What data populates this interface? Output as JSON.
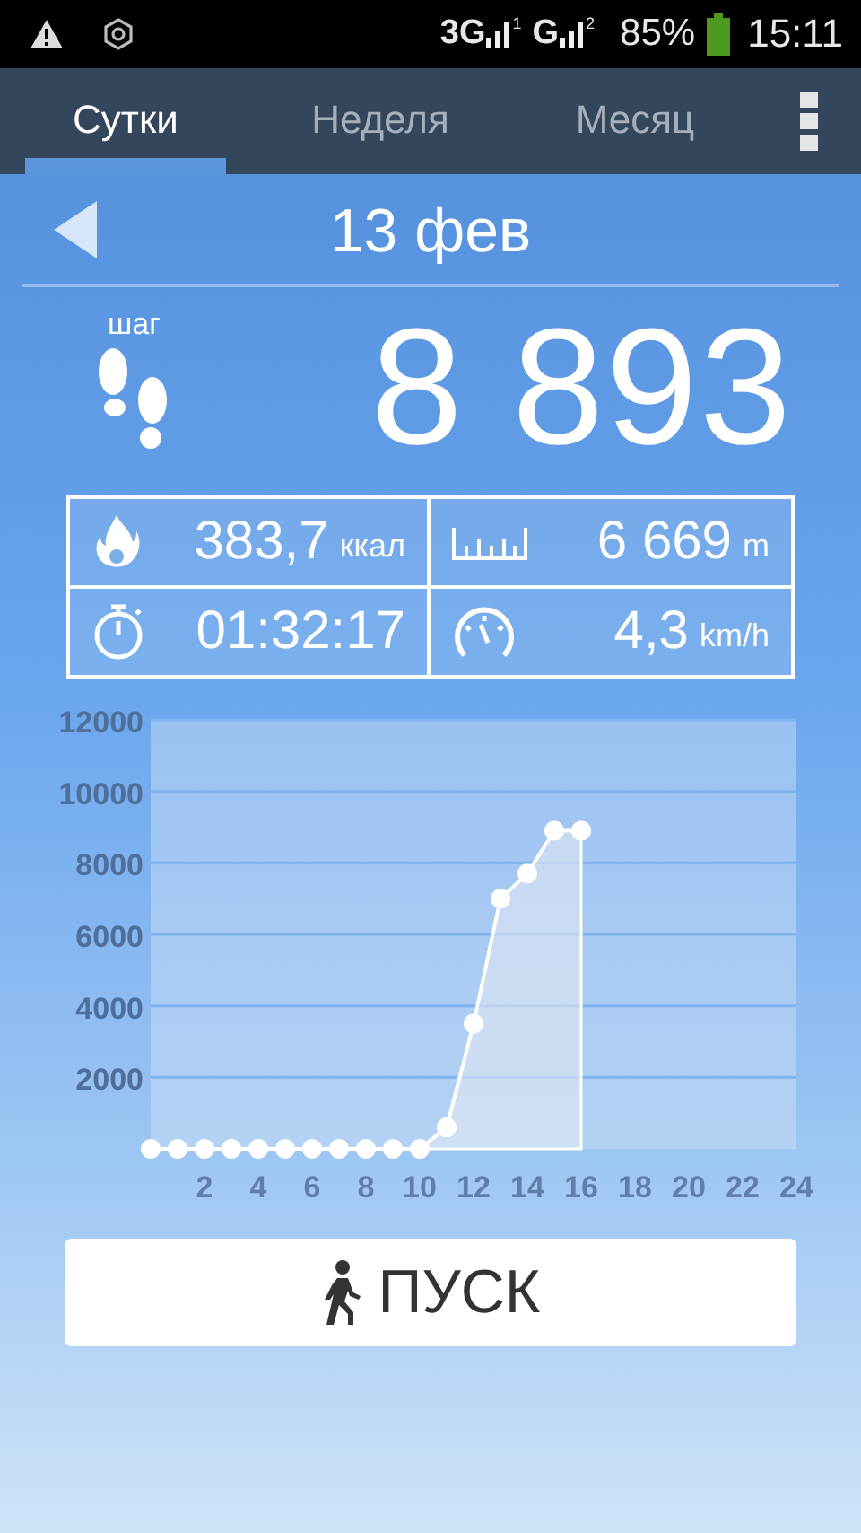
{
  "status_bar": {
    "network_1": "3G",
    "sim_1": "1",
    "network_2": "G",
    "sim_2": "2",
    "battery": "85%",
    "time": "15:11"
  },
  "tabs": [
    {
      "label": "Сутки",
      "selected": true
    },
    {
      "label": "Неделя",
      "selected": false
    },
    {
      "label": "Месяц",
      "selected": false
    }
  ],
  "date": "13 фев",
  "steps": {
    "label": "шаг",
    "value": "8 893"
  },
  "stats": [
    {
      "kind": "calories",
      "value": "383,7",
      "unit": "ккал"
    },
    {
      "kind": "distance",
      "value": "6 669",
      "unit": "m"
    },
    {
      "kind": "duration",
      "value": "01:32:17"
    },
    {
      "kind": "speed",
      "value": "4,3",
      "unit": "km/h"
    }
  ],
  "chart_data": {
    "type": "area",
    "x": [
      0,
      1,
      2,
      3,
      4,
      5,
      6,
      7,
      8,
      9,
      10,
      11,
      12,
      13,
      14,
      15,
      16
    ],
    "series": [
      {
        "color": "#ffffff",
        "values": [
          0,
          0,
          0,
          0,
          0,
          0,
          0,
          0,
          0,
          0,
          0,
          600,
          3500,
          7000,
          7700,
          8900,
          8900
        ]
      }
    ],
    "grid": true,
    "xlim": [
      0,
      24
    ],
    "ylim": [
      0,
      12000
    ],
    "xticks": [
      2,
      4,
      6,
      8,
      10,
      12,
      14,
      16,
      18,
      20,
      22,
      24
    ],
    "yticks": [
      2000,
      4000,
      6000,
      8000,
      10000,
      12000
    ]
  },
  "start_button": "ПУСК"
}
